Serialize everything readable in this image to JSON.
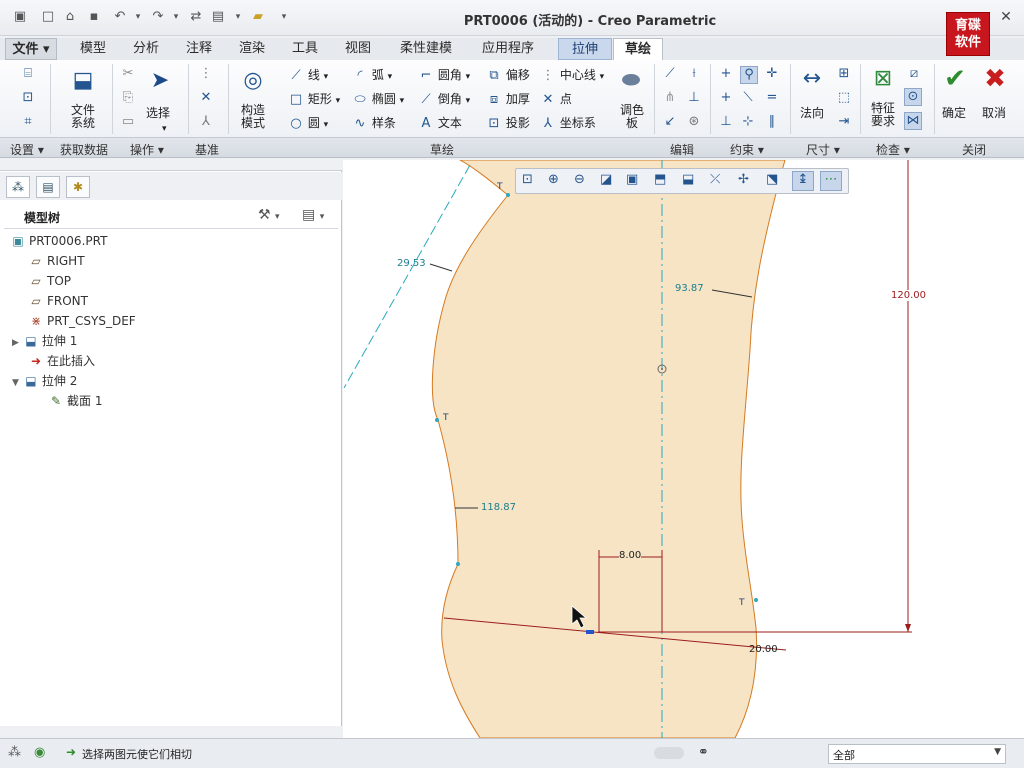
{
  "window": {
    "title": "PRT0006 (活动的) - Creo Parametric",
    "logo_text": "育碟软件"
  },
  "quick_access": [
    "new-icon",
    "open-icon",
    "save-icon",
    "undo-icon",
    "redo-icon",
    "regenerate-icon",
    "windows-icon",
    "close-window-icon",
    "customize-icon"
  ],
  "tabs": [
    {
      "label": "文件",
      "name": "tab-file"
    },
    {
      "label": "模型",
      "name": "tab-model"
    },
    {
      "label": "分析",
      "name": "tab-analysis"
    },
    {
      "label": "注释",
      "name": "tab-annotate"
    },
    {
      "label": "渲染",
      "name": "tab-render"
    },
    {
      "label": "工具",
      "name": "tab-tools"
    },
    {
      "label": "视图",
      "name": "tab-view"
    },
    {
      "label": "柔性建模",
      "name": "tab-flexible"
    },
    {
      "label": "应用程序",
      "name": "tab-apps"
    },
    {
      "label": "拉伸",
      "name": "tab-extrude"
    },
    {
      "label": "草绘",
      "name": "tab-sketch"
    }
  ],
  "ribbon": {
    "file_system": "文件\n系统",
    "select": "选择",
    "construction_mode": "构造\n模式",
    "sketch_tools": {
      "line": "线",
      "rectangle": "矩形",
      "circle": "圆",
      "arc": "弧",
      "ellipse": "椭圆",
      "spline": "样条",
      "fillet": "圆角",
      "chamfer": "倒角",
      "text": "文本",
      "offset": "偏移",
      "thicken": "加厚",
      "project": "投影",
      "centerline": "中心线",
      "point": "点",
      "coord_sys": "坐标系",
      "palette": "调色\n板"
    },
    "normal": "法向",
    "feature_req": "特征\n要求",
    "ok": "确定",
    "cancel": "取消"
  },
  "groups": {
    "setup": "设置",
    "get_data": "获取数据",
    "operations": "操作",
    "datum": "基准",
    "sketching": "草绘",
    "editing": "编辑",
    "constrain": "约束",
    "dimension": "尺寸",
    "inspect": "检查",
    "close": "关闭"
  },
  "model_tree": {
    "title": "模型树",
    "items": [
      {
        "label": "PRT0006.PRT",
        "icon": "part-icon"
      },
      {
        "label": "RIGHT",
        "icon": "datum-plane-icon"
      },
      {
        "label": "TOP",
        "icon": "datum-plane-icon"
      },
      {
        "label": "FRONT",
        "icon": "datum-plane-icon"
      },
      {
        "label": "PRT_CSYS_DEF",
        "icon": "csys-icon"
      },
      {
        "label": "拉伸 1",
        "icon": "extrude-icon"
      },
      {
        "label": "在此插入",
        "icon": "insert-here-icon"
      },
      {
        "label": "拉伸 2",
        "icon": "extrude-icon"
      },
      {
        "label": "截面 1",
        "icon": "section-icon"
      }
    ]
  },
  "sketch": {
    "dims": {
      "d1": "29.53",
      "d2": "93.87",
      "d3": "120.00",
      "d4": "118.87",
      "d5": "8.00",
      "d6": "20.00"
    },
    "tangent_marker": "T"
  },
  "status": {
    "message": "选择两图元使它们相切",
    "filter": "全部"
  }
}
